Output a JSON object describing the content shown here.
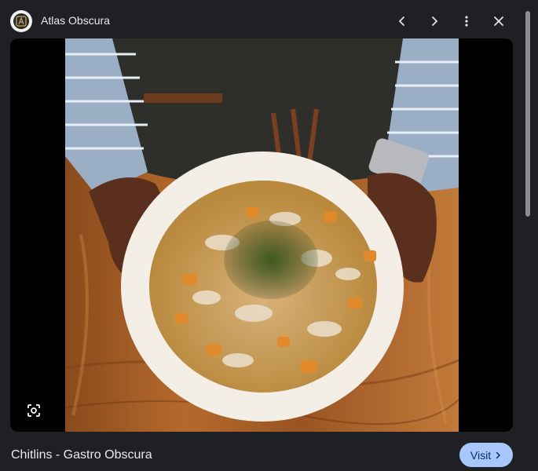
{
  "header": {
    "site_name": "Atlas Obscura",
    "icons": [
      "site-logo",
      "chevron-left-icon",
      "chevron-right-icon",
      "more-vert-icon",
      "close-icon"
    ]
  },
  "viewer": {
    "image_description": "hands holding bowl of chitlins soup with carrots and herbs on wooden table",
    "lens_icon": "google-lens-icon"
  },
  "footer": {
    "caption": "Chitlins - Gastro Obscura",
    "visit_label": "Visit"
  },
  "colors": {
    "background": "#1f2023",
    "visit_button": "#a8c7fa",
    "visit_text": "#062e6f"
  }
}
